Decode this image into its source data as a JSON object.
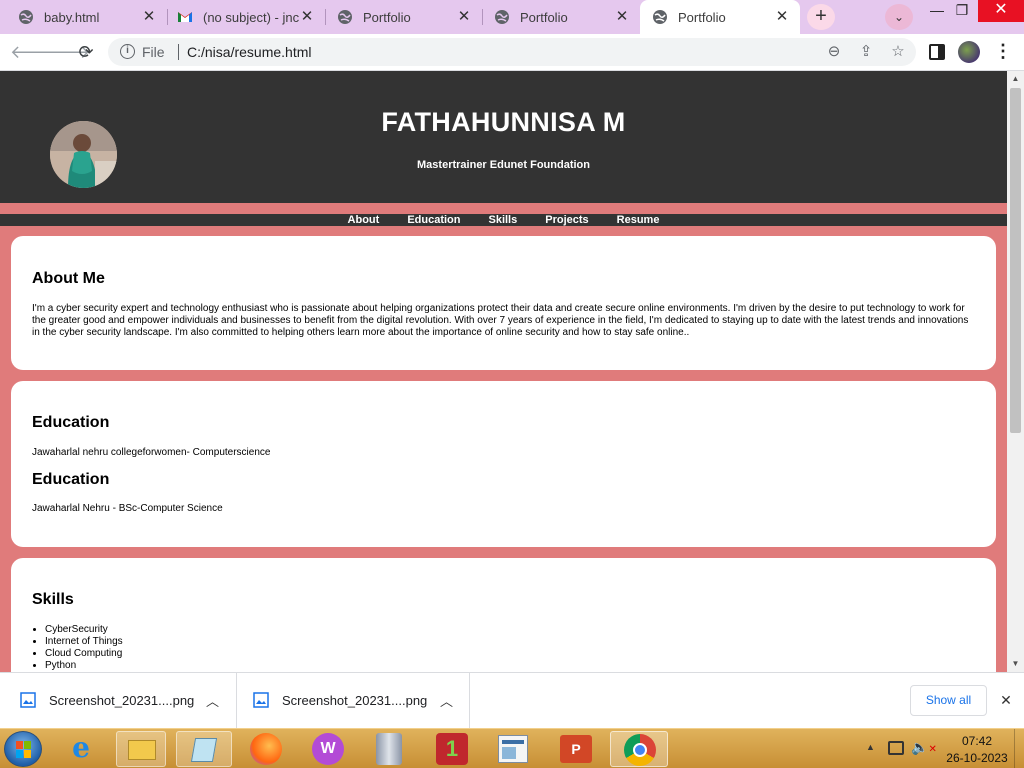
{
  "browser": {
    "tabs": [
      {
        "title": "baby.html",
        "icon": "globe-icon",
        "active": false
      },
      {
        "title": "(no subject) - jncw",
        "icon": "gmail-icon",
        "active": false
      },
      {
        "title": "Portfolio",
        "icon": "globe-icon",
        "active": false
      },
      {
        "title": "Portfolio",
        "icon": "globe-icon",
        "active": false
      },
      {
        "title": "Portfolio",
        "icon": "globe-icon",
        "active": true
      }
    ],
    "new_tab_symbol": "+",
    "tab_search_symbol": "⌄",
    "window_buttons": {
      "minimize": "—",
      "restore": "❐",
      "close": "✕"
    },
    "address": {
      "scheme": "File",
      "url": "C:/nisa/resume.html"
    }
  },
  "page": {
    "header": {
      "name": "FATHAHUNNISA M",
      "tagline": "Mastertrainer Edunet Foundation"
    },
    "nav": [
      "About",
      "Education",
      "Skills",
      "Projects",
      "Resume"
    ],
    "about": {
      "heading": "About Me",
      "text": "I'm a cyber security expert and technology enthusiast who is passionate about helping organizations protect their data and create secure online environments. I'm driven by the desire to put technology to work for the greater good and empower individuals and businesses to benefit from the digital revolution. With over 7 years of experience in the field, I'm dedicated to staying up to date with the latest trends and innovations in the cyber security landscape. I'm also committed to helping others learn more about the importance of online security and how to stay safe online.."
    },
    "education": [
      {
        "heading": "Education",
        "text": "Jawaharlal nehru collegeforwomen- Computerscience"
      },
      {
        "heading": "Education",
        "text": "Jawaharlal Nehru - BSc-Computer Science"
      }
    ],
    "skills": {
      "heading": "Skills",
      "items": [
        "CyberSecurity",
        "Internet of Things",
        "Cloud Computing",
        "Python"
      ]
    }
  },
  "downloads": {
    "items": [
      {
        "name": "Screenshot_20231....png"
      },
      {
        "name": "Screenshot_20231....png"
      }
    ],
    "show_all": "Show all",
    "close_symbol": "✕"
  },
  "taskbar": {
    "time": "07:42",
    "date": "26-10-2023",
    "apps": [
      "internet-explorer-icon",
      "file-explorer-icon",
      "notepad-icon",
      "firefox-icon",
      "wps-office-icon",
      "archive-icon",
      "onedrive-icon",
      "media-icon",
      "powerpoint-icon",
      "chrome-icon"
    ]
  },
  "colors": {
    "tabstrip": "#e5c8ee",
    "page_background": "#e07b7b",
    "header_background": "#333333",
    "taskbar": "#d3a14b"
  }
}
